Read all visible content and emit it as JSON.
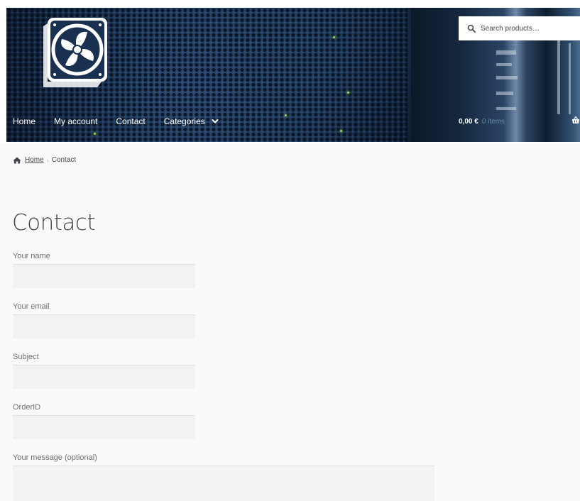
{
  "header": {
    "search": {
      "placeholder": "Search products…"
    },
    "nav": {
      "home": "Home",
      "my_account": "My account",
      "contact": "Contact",
      "categories": "Categories"
    },
    "cart": {
      "amount": "0,00 €",
      "count": "0 items"
    }
  },
  "breadcrumb": {
    "home": "Home",
    "separator": "›",
    "current": "Contact"
  },
  "main": {
    "title": "Contact",
    "form": {
      "fields": [
        {
          "label": "Your name",
          "value": ""
        },
        {
          "label": "Your email",
          "value": ""
        },
        {
          "label": "Subject",
          "value": ""
        },
        {
          "label": "OrderID",
          "value": ""
        },
        {
          "label": "Your message (optional)",
          "value": ""
        }
      ]
    }
  },
  "icons": {
    "logo": "fan-logo-icon",
    "search": "search-icon",
    "chevron": "chevron-down-icon",
    "basket": "basket-icon",
    "home": "home-icon"
  },
  "colors": {
    "text": "#43454b",
    "field_bg": "#f2f2f2",
    "header_dark": "#14263c"
  }
}
